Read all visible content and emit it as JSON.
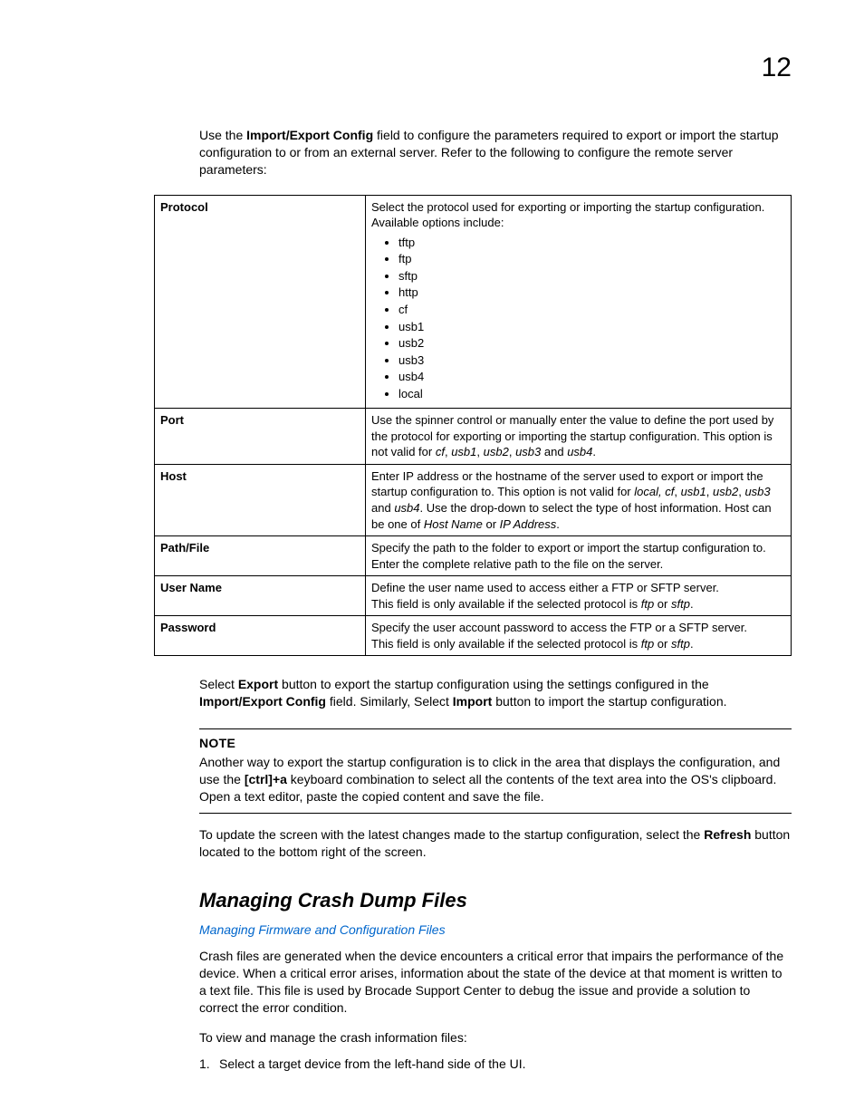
{
  "pageNumber": "12",
  "intro": {
    "pre": "Use the ",
    "b1": "Import/Export Config",
    "post": " field to configure the parameters required to export or import the startup configuration to or from an external server. Refer to the following to configure the remote server parameters:"
  },
  "table": {
    "rows": [
      {
        "label": "Protocol",
        "desc_pre": "Select the protocol used for exporting or importing the startup configuration. Available options include:",
        "items": [
          "tftp",
          "ftp",
          "sftp",
          "http",
          "cf",
          "usb1",
          "usb2",
          "usb3",
          "usb4",
          "local"
        ]
      },
      {
        "label": "Port",
        "parts": [
          {
            "t": "text",
            "v": "Use the spinner control or manually enter the value to define the port used by the protocol for exporting or importing the startup configuration. This option is not valid for "
          },
          {
            "t": "ital",
            "v": "cf"
          },
          {
            "t": "text",
            "v": ", "
          },
          {
            "t": "ital",
            "v": "usb1"
          },
          {
            "t": "text",
            "v": ", "
          },
          {
            "t": "ital",
            "v": "usb2"
          },
          {
            "t": "text",
            "v": ", "
          },
          {
            "t": "ital",
            "v": "usb3"
          },
          {
            "t": "text",
            "v": " and "
          },
          {
            "t": "ital",
            "v": "usb4"
          },
          {
            "t": "text",
            "v": "."
          }
        ]
      },
      {
        "label": "Host",
        "parts": [
          {
            "t": "text",
            "v": "Enter IP address or the hostname of the server used to export or import the startup configuration to. This option is not valid for "
          },
          {
            "t": "ital",
            "v": "local, cf"
          },
          {
            "t": "text",
            "v": ", "
          },
          {
            "t": "ital",
            "v": "usb1"
          },
          {
            "t": "text",
            "v": ", "
          },
          {
            "t": "ital",
            "v": "usb2"
          },
          {
            "t": "text",
            "v": ", "
          },
          {
            "t": "ital",
            "v": "usb3"
          },
          {
            "t": "text",
            "v": " and "
          },
          {
            "t": "ital",
            "v": "usb4"
          },
          {
            "t": "text",
            "v": ". Use the drop-down to select the type of host information. Host can be one of "
          },
          {
            "t": "ital",
            "v": "Host Name"
          },
          {
            "t": "text",
            "v": " or "
          },
          {
            "t": "ital",
            "v": "IP Address"
          },
          {
            "t": "text",
            "v": "."
          }
        ]
      },
      {
        "label": "Path/File",
        "parts": [
          {
            "t": "text",
            "v": "Specify the path to the folder to export or import the startup configuration to. Enter the complete relative path to the file on the server."
          }
        ]
      },
      {
        "label": "User Name",
        "lines": [
          [
            {
              "t": "text",
              "v": "Define the user name used to access either a FTP or SFTP server."
            }
          ],
          [
            {
              "t": "text",
              "v": "This field is only available if the selected protocol is "
            },
            {
              "t": "ital",
              "v": "ftp"
            },
            {
              "t": "text",
              "v": " or "
            },
            {
              "t": "ital",
              "v": "sftp"
            },
            {
              "t": "text",
              "v": "."
            }
          ]
        ]
      },
      {
        "label": "Password",
        "lines": [
          [
            {
              "t": "text",
              "v": "Specify the user account password to access the FTP or a SFTP server."
            }
          ],
          [
            {
              "t": "text",
              "v": "This field is only available if the selected protocol is "
            },
            {
              "t": "ital",
              "v": "ftp"
            },
            {
              "t": "text",
              "v": " or "
            },
            {
              "t": "ital",
              "v": "sftp"
            },
            {
              "t": "text",
              "v": "."
            }
          ]
        ]
      }
    ]
  },
  "afterTable": {
    "p1": "Select ",
    "b1": "Export",
    "p2": " button to export the startup configuration using the settings configured in the ",
    "b2": "Import/Export Config",
    "p3": " field. Similarly, Select ",
    "b3": "Import",
    "p4": " button to import the startup configuration."
  },
  "note": {
    "title": "NOTE",
    "p1": "Another way to export the startup configuration is to click in the area that displays the configuration, and use the ",
    "b1": "[ctrl]+a",
    "p2": " keyboard combination to select all the contents of the text area into the OS's clipboard. Open a text editor, paste the copied content and save the file."
  },
  "refresh": {
    "p1": "To update the screen with the latest changes made to the startup configuration, select the ",
    "b1": "Refresh",
    "p2": " button located to the bottom right of the screen."
  },
  "section": {
    "heading": "Managing Crash Dump Files",
    "link": "Managing Firmware and Configuration Files",
    "para": "Crash files are generated when the device encounters a critical error that impairs the performance of the device. When a critical error arises, information about the state of the device at that moment is written to a text file. This file is used by Brocade Support Center to debug the issue and provide a solution to correct the error condition.",
    "para2": "To view and manage the crash information files:",
    "step1num": "1.",
    "step1": "Select a target device from the left-hand side of the UI."
  }
}
